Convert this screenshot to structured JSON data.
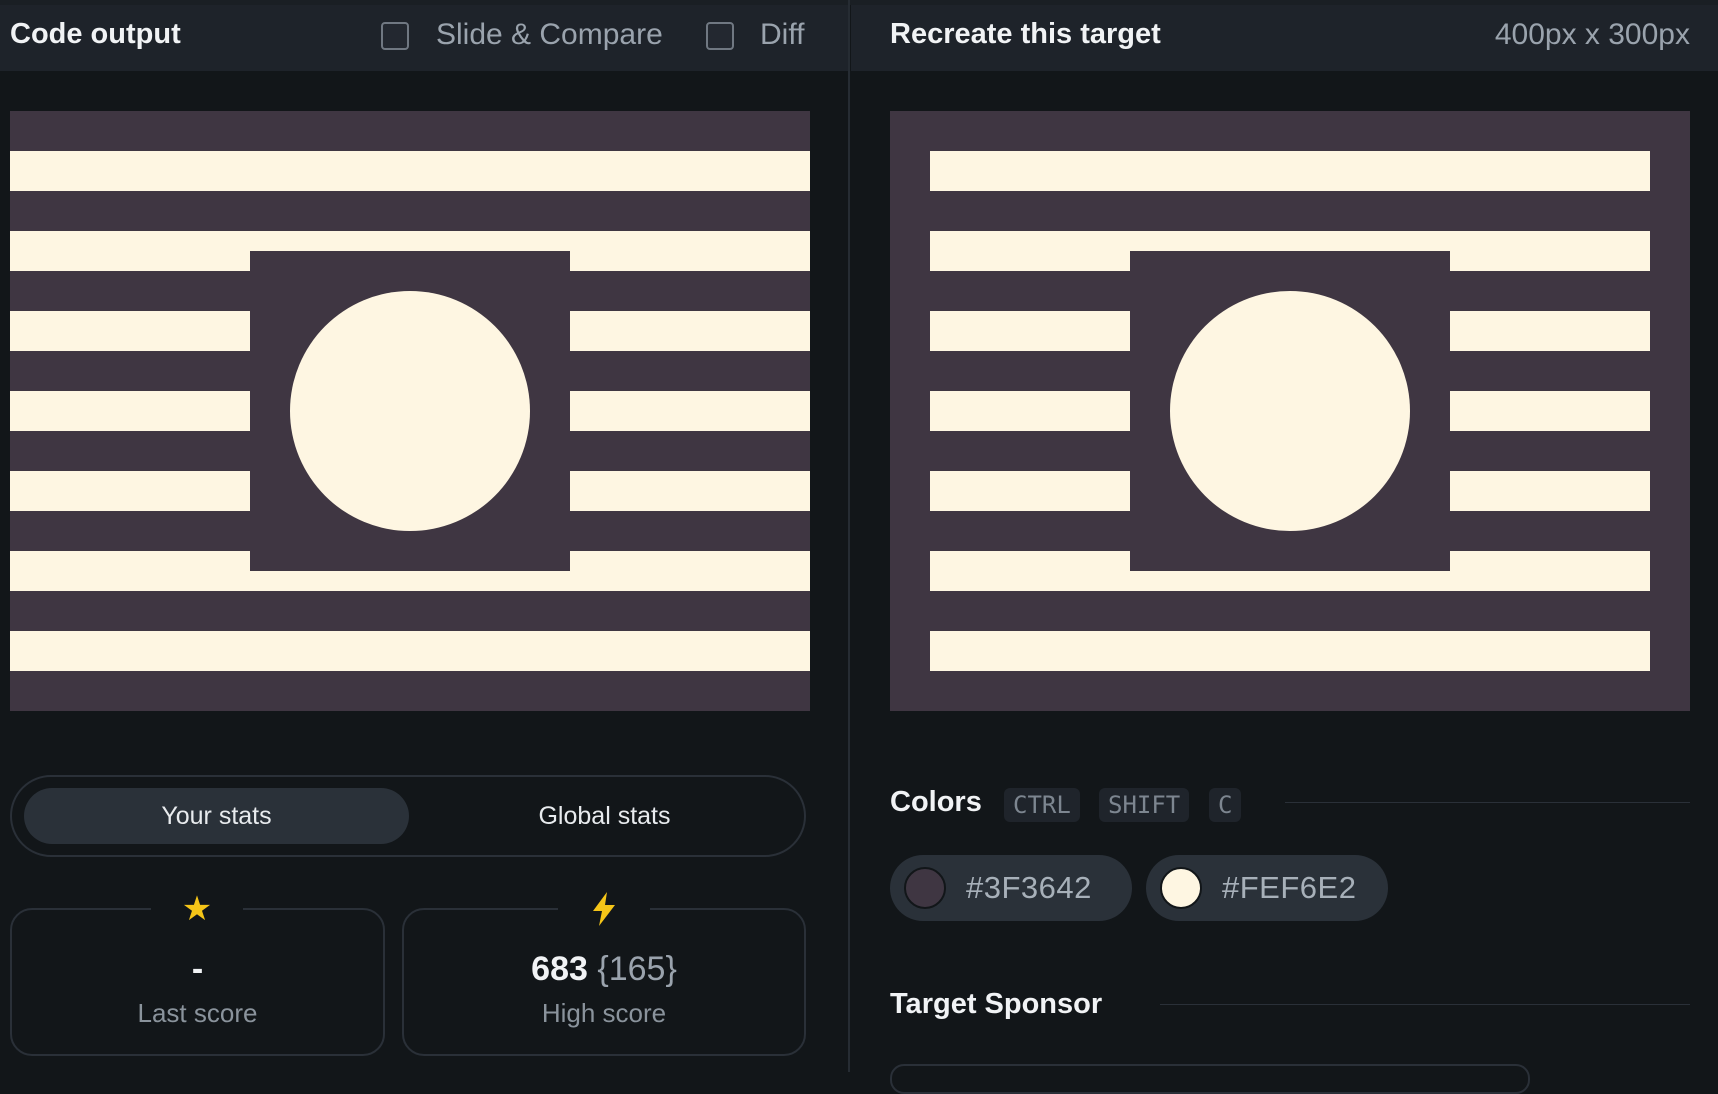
{
  "left_panel": {
    "title": "Code output",
    "slide_compare_label": "Slide & Compare",
    "diff_label": "Diff"
  },
  "right_panel": {
    "title": "Recreate this target",
    "dimensions": "400px x 300px"
  },
  "stats": {
    "tabs": {
      "your_stats": "Your stats",
      "global_stats": "Global stats"
    },
    "last_score": {
      "icon": "star-icon",
      "value": "-",
      "label": "Last score"
    },
    "high_score": {
      "icon": "lightning-icon",
      "value": "683",
      "sub_value": "{165}",
      "label": "High score"
    }
  },
  "colors_section": {
    "title": "Colors",
    "shortcut_keys": [
      "CTRL",
      "SHIFT",
      "C"
    ],
    "swatches": [
      {
        "hex": "#3F3642",
        "label": "#3F3642"
      },
      {
        "hex": "#FEF6E2",
        "label": "#FEF6E2"
      }
    ]
  },
  "sponsor_section": {
    "title": "Target Sponsor"
  },
  "target_colors": {
    "background": "#3F3642",
    "foreground": "#FEF6E2"
  }
}
